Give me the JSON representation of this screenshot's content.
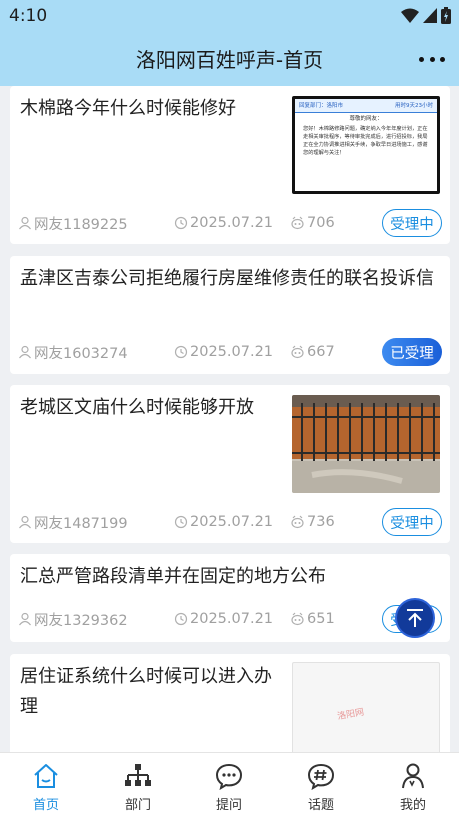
{
  "status_bar": {
    "time": "4:10"
  },
  "header": {
    "title": "洛阳网百姓呼声-首页"
  },
  "posts": [
    {
      "title": "木棉路今年什么时候能修好",
      "user": "网友1189225",
      "date": "2025.07.21",
      "views": "706",
      "status": "受理中",
      "thumb": {
        "dept_label": "回复部门：",
        "dept_name": "洛阳市",
        "reply_date": "用时9天23小时",
        "greeting": "尊敬的网友：",
        "body": "您好！木棉路修路问题，确定纳入今年年度计划，正在走相关审批程序，等待审批完成后，进行招投标，我局正在全力协调推进相关手续，争取早日进场施工，感谢您的理解与关注！"
      }
    },
    {
      "title": "孟津区吉泰公司拒绝履行房屋维修责任的联名投诉信",
      "user": "网友1603274",
      "date": "2025.07.21",
      "views": "667",
      "status": "已受理"
    },
    {
      "title": "老城区文庙什么时候能够开放",
      "user": "网友1487199",
      "date": "2025.07.21",
      "views": "736",
      "status": "受理中"
    },
    {
      "title": "汇总严管路段清单并在固定的地方公布",
      "user": "网友1329362",
      "date": "2025.07.21",
      "views": "651",
      "status": "受理中"
    },
    {
      "title": "居住证系统什么时候可以进入办理",
      "thumb_stamp": "洛阳网"
    }
  ],
  "tabs": [
    {
      "label": "首页",
      "icon": "home-icon"
    },
    {
      "label": "部门",
      "icon": "org-chart-icon"
    },
    {
      "label": "提问",
      "icon": "chat-bubble-icon"
    },
    {
      "label": "话题",
      "icon": "hashtag-chat-icon"
    },
    {
      "label": "我的",
      "icon": "user-icon"
    }
  ],
  "colors": {
    "header_bg": "#a9dcf6",
    "accent": "#1a8ee0",
    "badge_accepted": "#1a5fd8",
    "fab": "#123a9a"
  }
}
